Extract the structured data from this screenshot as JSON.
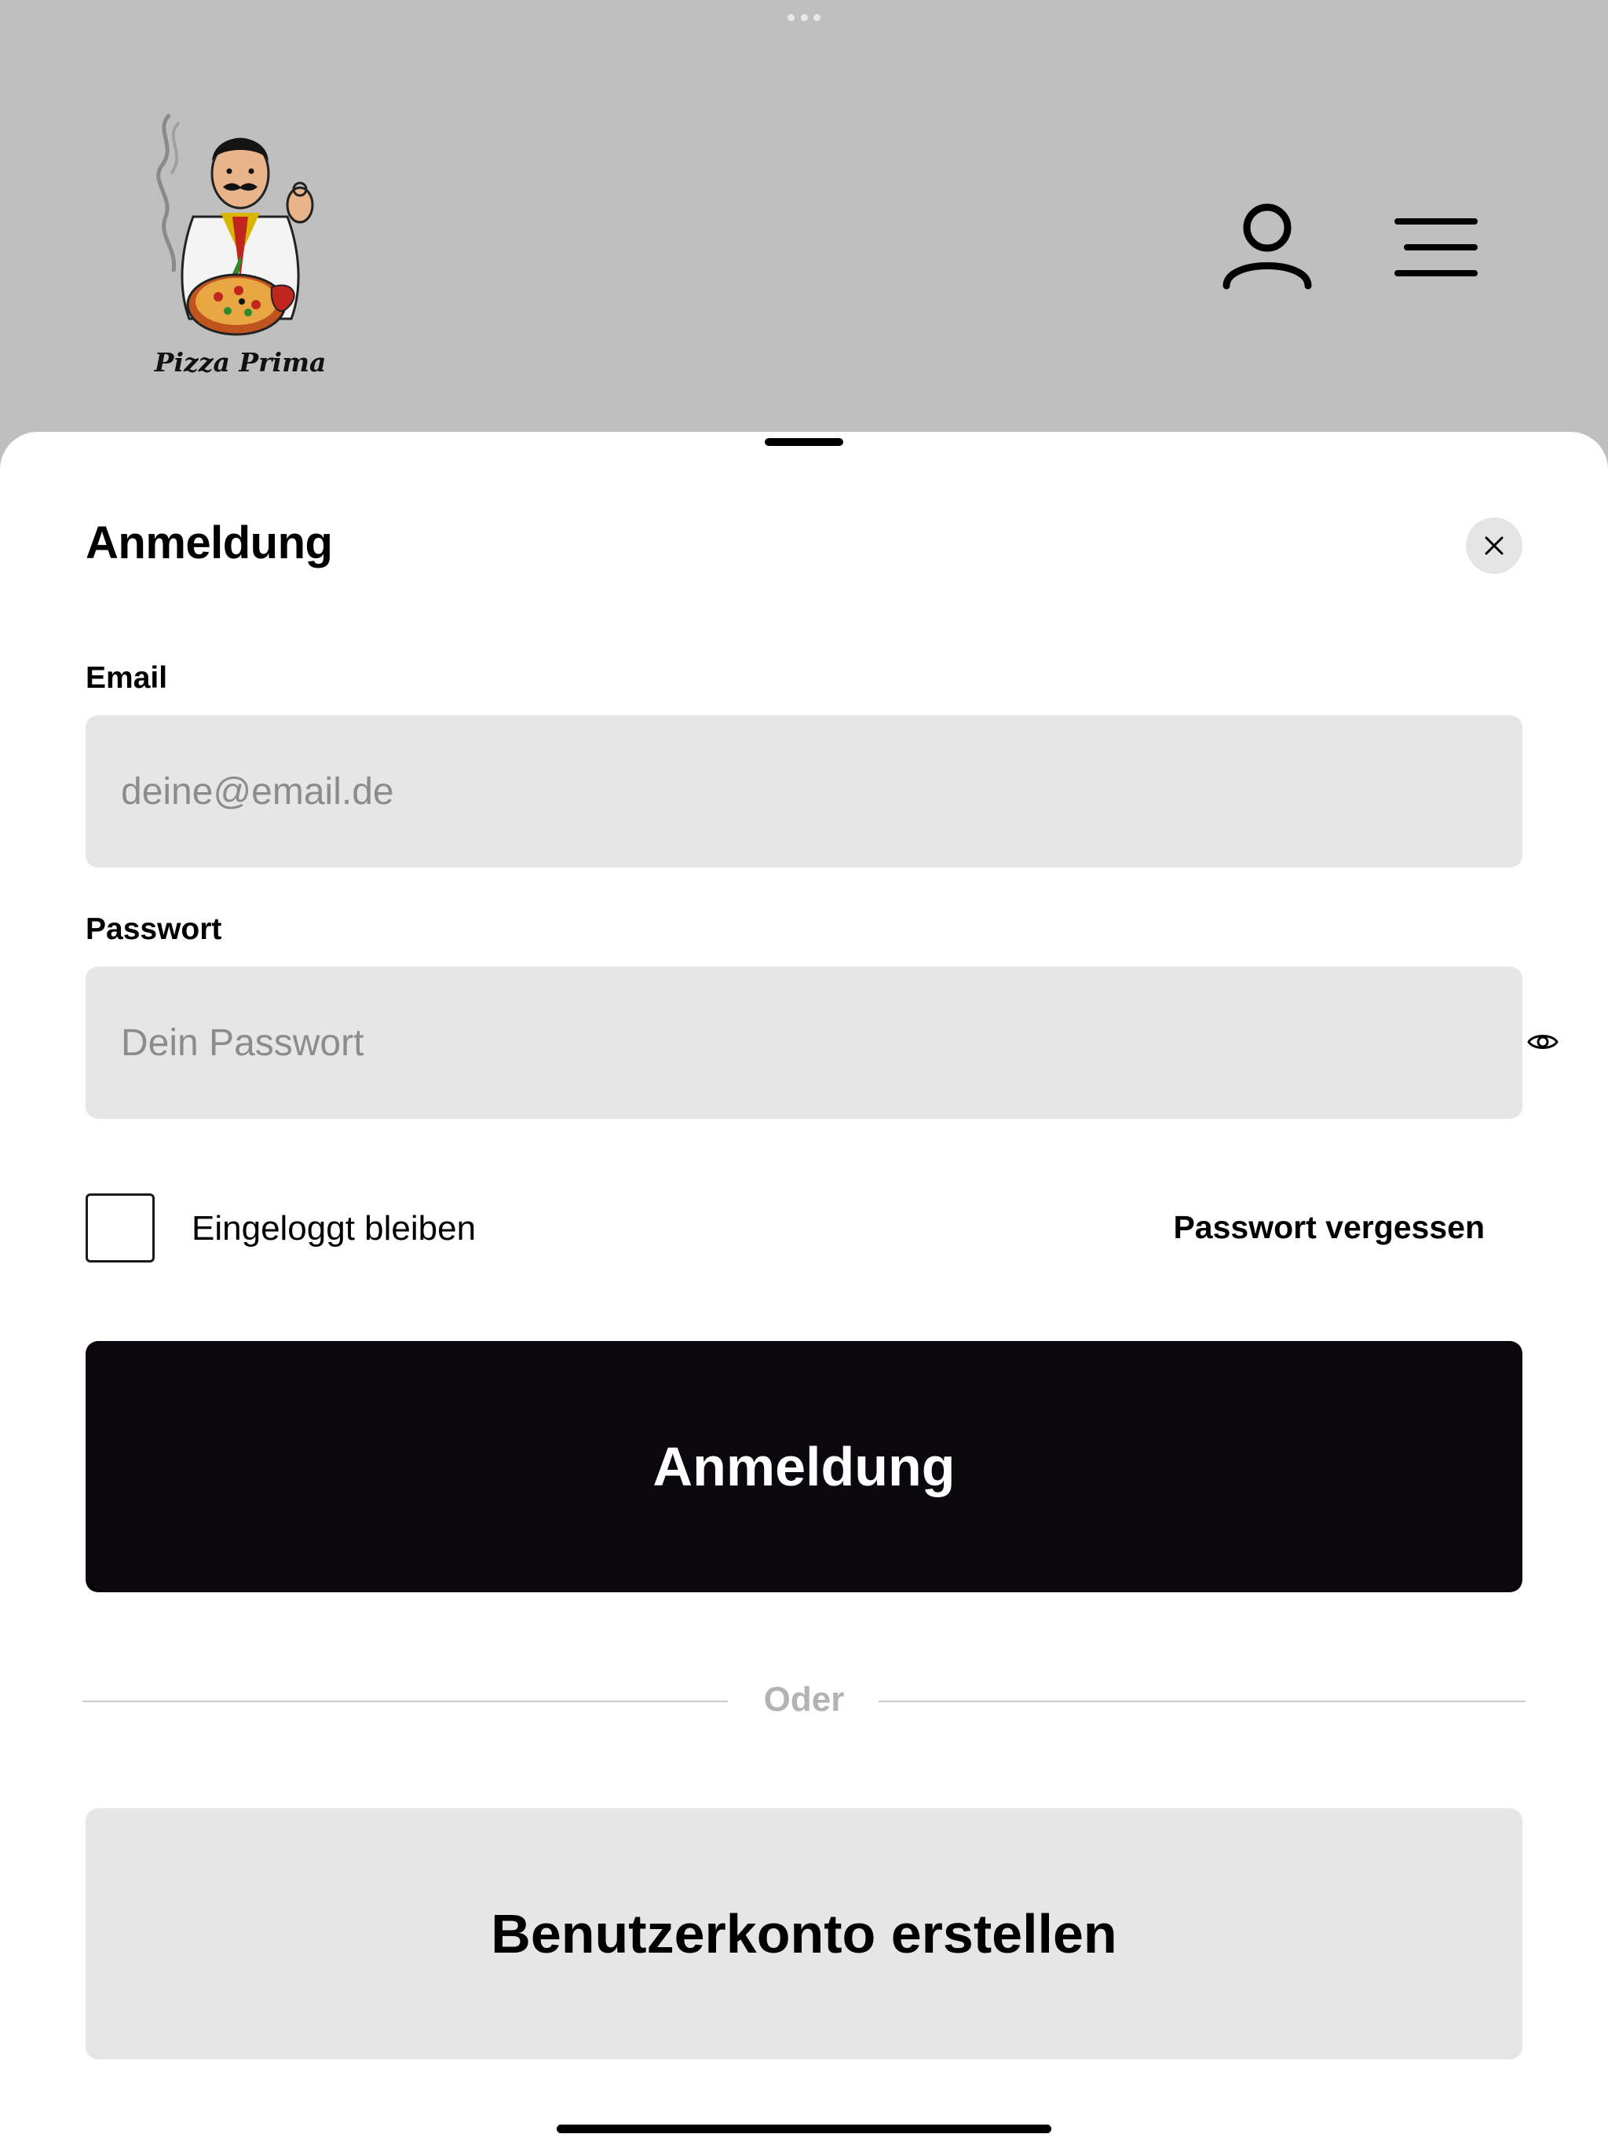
{
  "app": {
    "brand_name": "Pizza Prima"
  },
  "header": {
    "user_icon": "user-icon",
    "menu_icon": "menu-icon"
  },
  "login_sheet": {
    "title": "Anmeldung",
    "close_icon": "close-icon",
    "email": {
      "label": "Email",
      "placeholder": "deine@email.de",
      "value": ""
    },
    "password": {
      "label": "Passwort",
      "placeholder": "Dein Passwort",
      "value": "",
      "toggle_icon": "eye-icon"
    },
    "remember_me": {
      "label": "Eingeloggt bleiben",
      "checked": false
    },
    "forgot_password_label": "Passwort vergessen",
    "submit_label": "Anmeldung",
    "divider_label": "Oder",
    "register_label": "Benutzerkonto erstellen"
  },
  "colors": {
    "header_background": "#bfbfbf",
    "input_background": "#e6e6e6",
    "primary_button": "#0b080d",
    "secondary_button": "#e6e6e6"
  }
}
